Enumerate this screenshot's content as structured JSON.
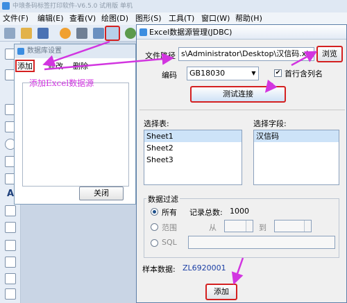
{
  "app": {
    "title": "中琅条码标签打印软件-V6.5.0 试用版 单机",
    "menu": [
      "文件(F)",
      "编辑(E)",
      "查看(V)",
      "绘图(D)",
      "图形(S)",
      "工具(T)",
      "窗口(W)",
      "帮助(H)"
    ]
  },
  "db_dialog": {
    "title": "数据库设置",
    "menu": {
      "add": "添加",
      "edit": "修改",
      "delete": "删除"
    },
    "close_label": "关闭"
  },
  "annotation": "添加Excel数据源",
  "excel_dialog": {
    "title": "Excel数据源管理(JDBC)",
    "file_path_label": "文件路径",
    "file_path_value": "s\\Administrator\\Desktop\\汉信码.xls",
    "browse_label": "浏览",
    "encoding_label": "编码",
    "encoding_value": "GB18030",
    "first_row_label": "首行含列名",
    "first_row_checked": true,
    "test_button": "测试连接",
    "select_table_label": "选择表:",
    "tables": [
      "Sheet1",
      "Sheet2",
      "Sheet3"
    ],
    "selected_table": "Sheet1",
    "select_field_label": "选择字段:",
    "fields": [
      "汉信码"
    ],
    "filter": {
      "title": "数据过滤",
      "all_label": "所有",
      "record_count_label": "记录总数:",
      "record_count": "1000",
      "range_label": "范围",
      "from_label": "从",
      "to_label": "到",
      "sql_label": "SQL",
      "selected": "all"
    },
    "sample_label": "样本数据:",
    "sample_value": "ZL6920001",
    "add_button": "添加"
  },
  "colors": {
    "annotation": "#d235e0",
    "highlight": "#d42020"
  }
}
